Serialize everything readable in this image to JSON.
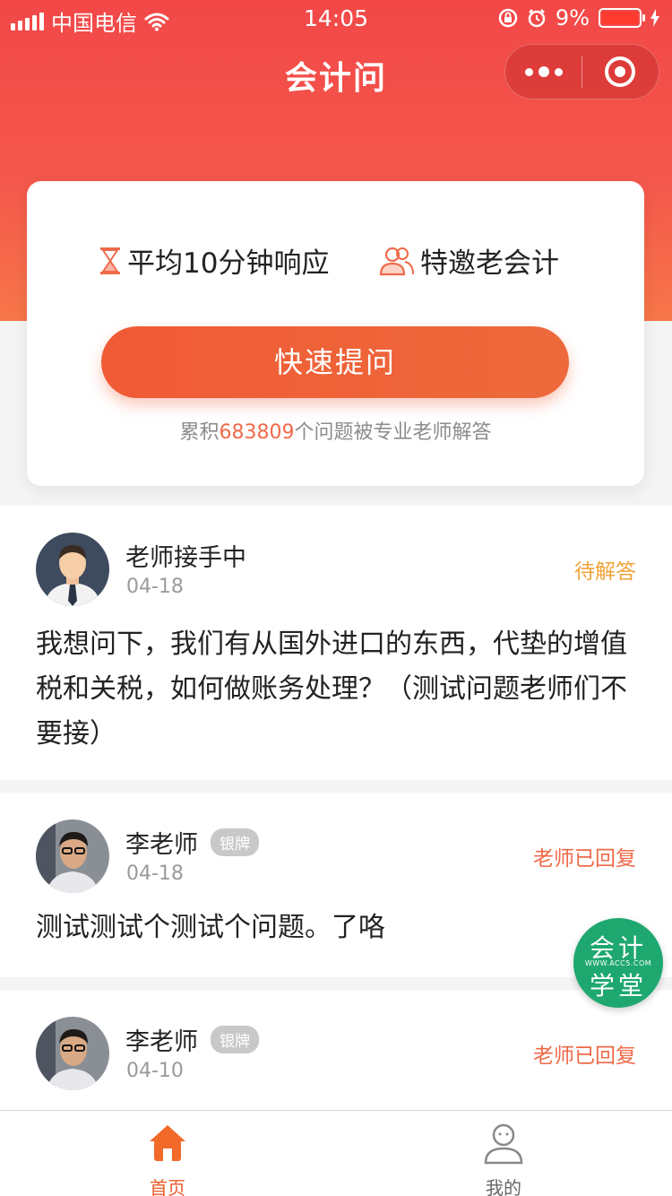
{
  "status_bar": {
    "carrier": "中国电信",
    "time": "14:05",
    "battery_percent": "9%"
  },
  "nav": {
    "title": "会计问"
  },
  "hero": {
    "feature1": "平均10分钟响应",
    "feature2": "特邀老会计",
    "ask_button": "快速提问",
    "stats_prefix": "累积",
    "stats_count": "683809",
    "stats_suffix": "个问题被专业老师解答"
  },
  "questions": [
    {
      "name": "老师接手中",
      "date": "04-18",
      "status": "待解答",
      "text": "我想问下，我们有从国外进口的东西，代垫的增值税和关税，如何做账务处理？（测试问题老师们不要接）"
    },
    {
      "name": "李老师",
      "badge": "银牌",
      "date": "04-18",
      "status": "老师已回复",
      "text": "测试测试个测试个问题。了咯"
    },
    {
      "name": "李老师",
      "badge": "银牌",
      "date": "04-10",
      "status": "老师已回复"
    }
  ],
  "float_badge": {
    "line1": "会计",
    "line2": "WWW.ACC5.COM",
    "line3": "学堂"
  },
  "tabbar": {
    "home": "首页",
    "mine": "我的"
  },
  "colors": {
    "header_red": "#f24848",
    "accent_orange": "#ee5a2a",
    "pending": "#f0a43a",
    "replied": "#ef6a48",
    "badge_green": "#1ea870"
  }
}
